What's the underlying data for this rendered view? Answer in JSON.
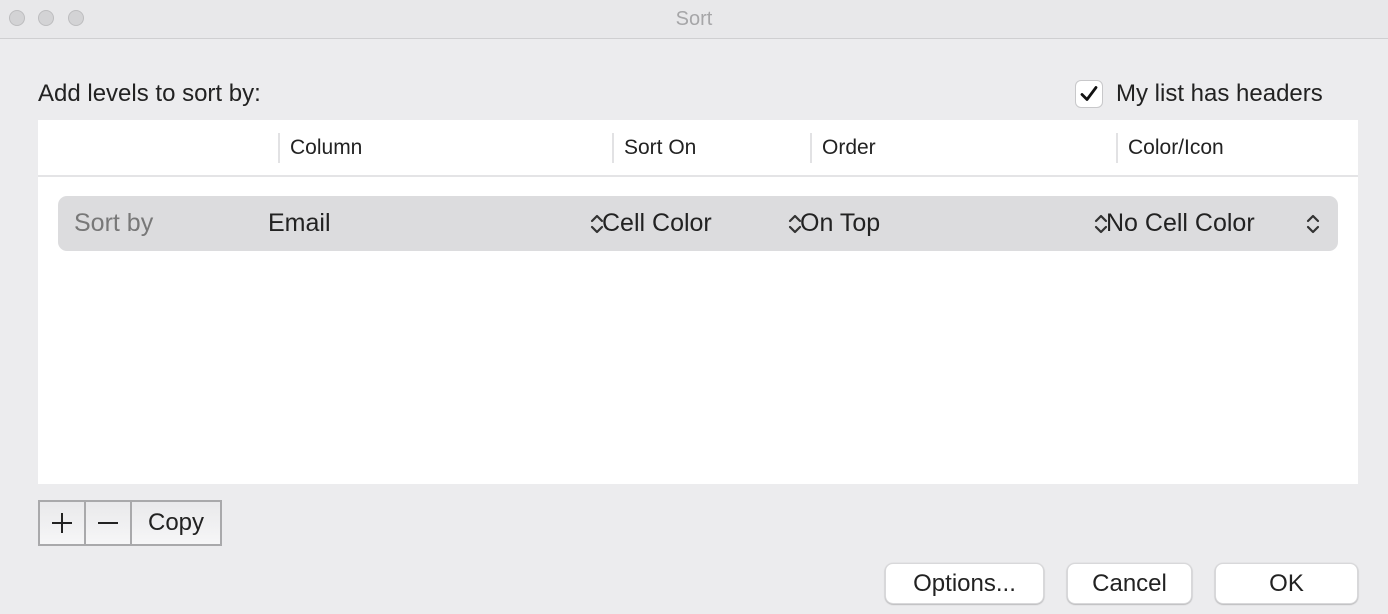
{
  "window": {
    "title": "Sort",
    "traffic_lights": [
      "close",
      "minimize",
      "zoom"
    ]
  },
  "dialog": {
    "add_levels_label": "Add levels to sort by:",
    "headers_checkbox": {
      "label": "My list has headers",
      "checked": true
    }
  },
  "table": {
    "columns": [
      "Column",
      "Sort On",
      "Order",
      "Color/Icon"
    ],
    "rows": [
      {
        "level_label": "Sort by",
        "column": "Email",
        "sort_on": "Cell Color",
        "order": "On Top",
        "color_icon": "No Cell Color"
      }
    ]
  },
  "level_buttons": {
    "add": "+",
    "remove": "—",
    "copy": "Copy"
  },
  "actions": {
    "options": "Options...",
    "cancel": "Cancel",
    "ok": "OK"
  }
}
